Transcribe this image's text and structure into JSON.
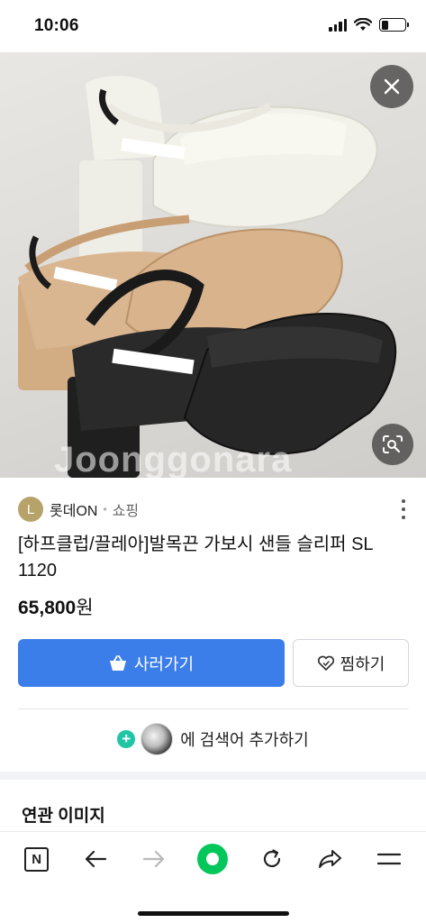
{
  "status_bar": {
    "time": "10:06",
    "signal_level": 4,
    "battery_level": 0.3
  },
  "hero": {
    "watermark": "Joonggonara",
    "close_icon": "close-icon",
    "lens_icon": "image-search-icon"
  },
  "seller": {
    "logo_letter": "L",
    "name": "롯데ON",
    "separator": "•",
    "category": "쇼핑"
  },
  "product": {
    "title": "[하프클럽/끌레아]발목끈 가보시 샌들 슬리퍼 SL 1120",
    "price": "65,800",
    "price_unit": "원"
  },
  "actions": {
    "buy_label": "사러가기",
    "wish_label": "찜하기",
    "add_search_text": "에 검색어 추가하기"
  },
  "related": {
    "title": "연관 이미지"
  },
  "colors": {
    "buy_button": "#3b7de9",
    "naver_green": "#03c75a",
    "plus_badge": "#1ec6a6"
  },
  "nav": {
    "items": [
      "naver-n-icon",
      "back-arrow-icon",
      "forward-arrow-icon",
      "green-dot-icon",
      "refresh-icon",
      "share-icon",
      "menu-icon"
    ],
    "n_letter": "N"
  }
}
